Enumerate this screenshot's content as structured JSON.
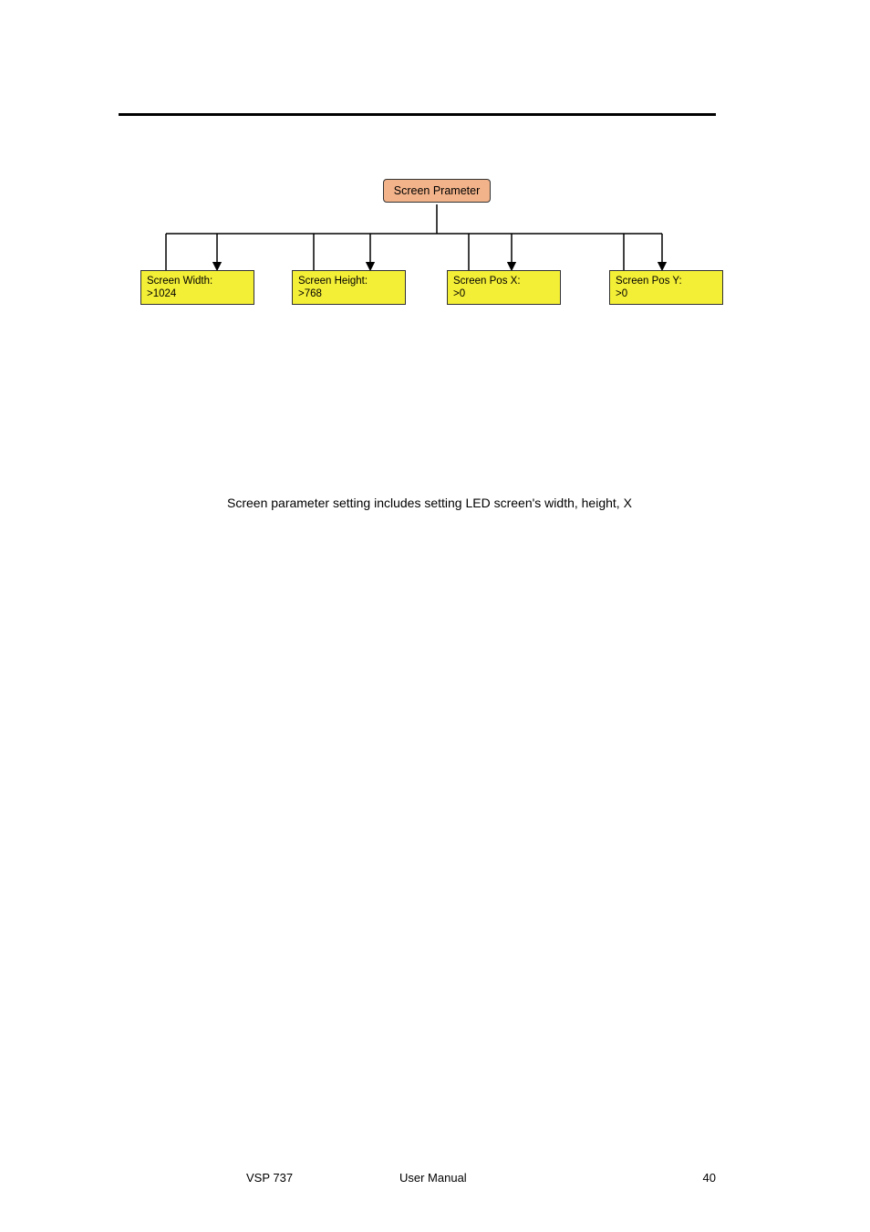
{
  "diagram": {
    "root": {
      "label": "Screen Prameter"
    },
    "children": [
      {
        "line1": "Screen Width:",
        "line2": ">1024"
      },
      {
        "line1": "Screen Height:",
        "line2": ">768"
      },
      {
        "line1": "Screen Pos X:",
        "line2": ">0"
      },
      {
        "line1": "Screen Pos Y:",
        "line2": ">0"
      }
    ]
  },
  "body": {
    "paragraph": "Screen parameter setting includes setting LED screen's width, height, X"
  },
  "footer": {
    "left": "VSP 737",
    "center": "User Manual",
    "right": "40"
  },
  "chart_data": {
    "type": "tree",
    "root": "Screen Prameter",
    "children": [
      "Screen Width: >1024",
      "Screen Height: >768",
      "Screen Pos X: >0",
      "Screen Pos Y: >0"
    ]
  }
}
